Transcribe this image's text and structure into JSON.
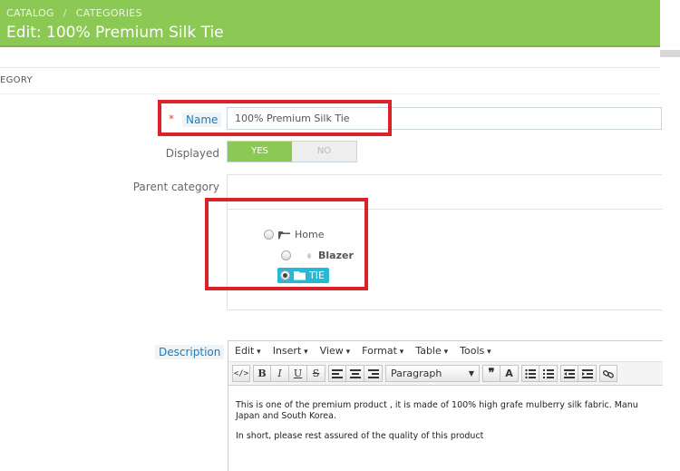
{
  "header": {
    "breadcrumb": [
      "CATALOG",
      "CATEGORIES"
    ],
    "breadcrumb_sep": "/",
    "title": "Edit: 100% Premium Silk Tie",
    "bg_color": "#8bc954"
  },
  "panel": {
    "heading": "EGORY"
  },
  "form": {
    "name_required_mark": "*",
    "name_label": "Name",
    "name_value": "100% Premium Silk Tie",
    "displayed_label": "Displayed",
    "displayed_yes": "YES",
    "displayed_no": "NO",
    "displayed_value": "YES",
    "parent_label": "Parent category",
    "tree": {
      "home": {
        "label": "Home",
        "icon": "folder-open-icon",
        "selected": false
      },
      "blazer": {
        "label": "Blazer",
        "icon": "leaf-dot-icon",
        "selected": false
      },
      "tie": {
        "label": "TIE",
        "icon": "folder-icon",
        "selected": true
      }
    },
    "description_label": "Description"
  },
  "editor": {
    "menu": [
      "Edit",
      "Insert",
      "View",
      "Format",
      "Table",
      "Tools"
    ],
    "toolbar": {
      "source": "</>",
      "bold": "B",
      "italic": "I",
      "underline": "U",
      "strike": "S",
      "format_select": "Paragraph",
      "quote": "❞",
      "font_color": "A"
    },
    "content": [
      "This is one of the premium product , it is made of 100% high grafe mulberry silk fabric. Manu",
      "Japan and South Korea.",
      "In short, please rest assured of the quality of this product"
    ]
  },
  "colors": {
    "accent": "#25b9d7",
    "success": "#8bc954",
    "annotation": "#d9222a"
  }
}
